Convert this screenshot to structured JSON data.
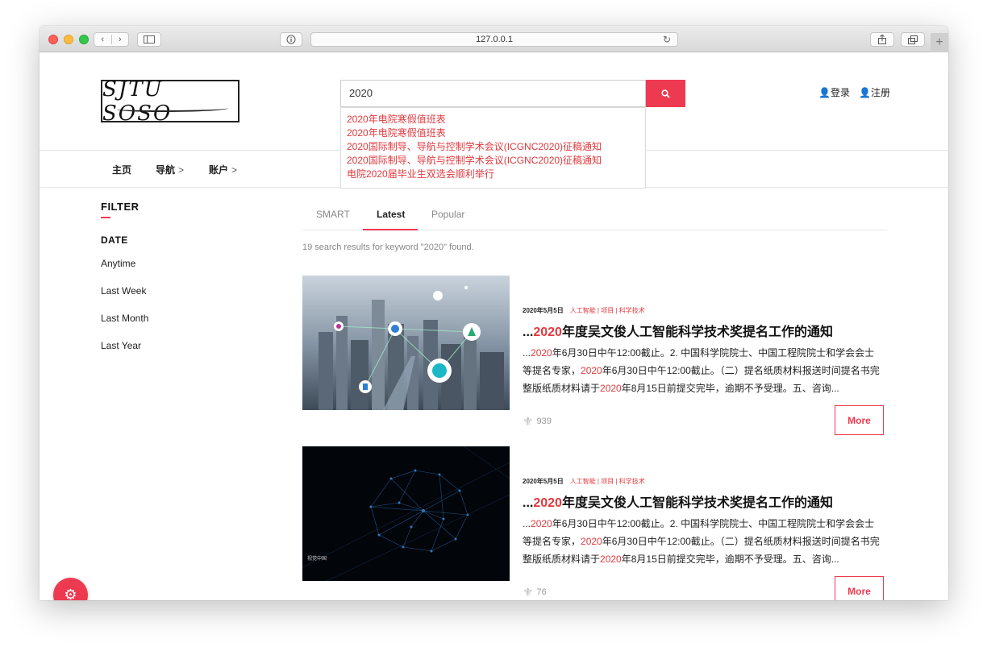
{
  "browser": {
    "url": "127.0.0.1",
    "back_icon": "chevron-left-icon",
    "forward_icon": "chevron-right-icon"
  },
  "header": {
    "logo_text": "SJTU SOSO",
    "search_value": "2020",
    "login": "登录",
    "register": "注册"
  },
  "suggestions": [
    "2020年电院寒假值班表",
    "2020年电院寒假值班表",
    "2020国际制导、导航与控制学术会议(ICGNC2020)征稿通知",
    "2020国际制导、导航与控制学术会议(ICGNC2020)征稿通知",
    "电院2020届毕业生双选会顺利举行"
  ],
  "nav": {
    "home": "主页",
    "guide": "导航",
    "account": "账户"
  },
  "filter": {
    "title": "FILTER",
    "date_title": "DATE",
    "options": [
      "Anytime",
      "Last Week",
      "Last Month",
      "Last Year"
    ]
  },
  "tabs": [
    "SMART",
    "Latest",
    "Popular"
  ],
  "active_tab": "Latest",
  "result_count": "19 search results for keyword \"2020\" found.",
  "results": [
    {
      "date": "2020年5月5日",
      "tags": "人工智能 | 项目 | 科学技术",
      "title_prefix": "...",
      "title_highlight": "2020",
      "title_rest": "年度吴文俊人工智能科学技术奖提名工作的通知",
      "excerpt_1a": "...",
      "excerpt_1b": "2020",
      "excerpt_1c": "年6月30日中午12:00截止。2. 中国科学院院士、中国工程院院士和学会会士等提名专家，",
      "excerpt_1d": "2020",
      "excerpt_1e": "年6月30日中午12:00截止。（二）提名纸质材料报送时间提名书完整版纸质材料请于",
      "excerpt_1f": "2020",
      "excerpt_1g": "年8月15日前提交完毕，逾期不予受理。五、咨询...",
      "views": "939",
      "more": "More"
    },
    {
      "date": "2020年5月5日",
      "tags": "人工智能 | 项目 | 科学技术",
      "title_prefix": "...",
      "title_highlight": "2020",
      "title_rest": "年度吴文俊人工智能科学技术奖提名工作的通知",
      "excerpt_1a": "...",
      "excerpt_1b": "2020",
      "excerpt_1c": "年6月30日中午12:00截止。2. 中国科学院院士、中国工程院院士和学会会士等提名专家，",
      "excerpt_1d": "2020",
      "excerpt_1e": "年6月30日中午12:00截止。（二）提名纸质材料报送时间提名书完整版纸质材料请于",
      "excerpt_1f": "2020",
      "excerpt_1g": "年8月15日前提交完毕，逾期不予受理。五、咨询...",
      "views": "76",
      "more": "More",
      "image_caption": "视觉中国"
    }
  ],
  "colors": {
    "accent": "#ee3a50"
  }
}
